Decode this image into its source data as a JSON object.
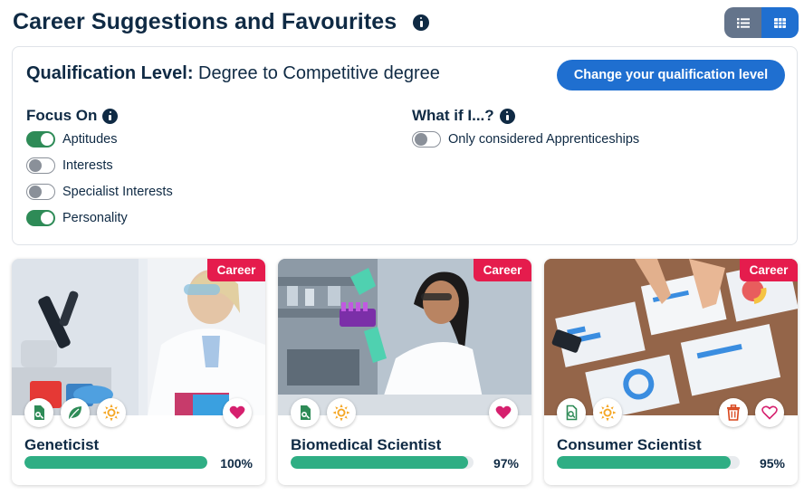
{
  "header": {
    "title": "Career Suggestions and Favourites",
    "info_icon": "info-icon",
    "view_toggle": {
      "list_icon": "list-icon",
      "grid_icon": "grid-icon",
      "active": "grid"
    }
  },
  "qualification": {
    "label": "Qualification Level:",
    "value": "Degree to Competitive degree",
    "change_button": "Change your qualification level"
  },
  "focus_on": {
    "heading": "Focus On",
    "toggles": [
      {
        "label": "Aptitudes",
        "on": true
      },
      {
        "label": "Interests",
        "on": false
      },
      {
        "label": "Specialist Interests",
        "on": false
      },
      {
        "label": "Personality",
        "on": true
      }
    ]
  },
  "what_if": {
    "heading": "What if I...?",
    "toggles": [
      {
        "label": "Only considered Apprenticeships",
        "on": false
      }
    ]
  },
  "colors": {
    "brand_blue": "#1f6fd0",
    "navy": "#0f2a44",
    "toggle_on": "#2e8b57",
    "progress": "#2fae84",
    "badge": "#e51c4d",
    "favourite": "#d6206e"
  },
  "careers": [
    {
      "badge": "Career",
      "name": "Geneticist",
      "match": "100%",
      "match_value": 100,
      "icons": [
        "aptitude-doc-icon",
        "leaf-icon",
        "sun-icon"
      ],
      "action_icons": [
        "heart-filled-icon"
      ]
    },
    {
      "badge": "Career",
      "name": "Biomedical Scientist",
      "match": "97%",
      "match_value": 97,
      "icons": [
        "aptitude-doc-icon",
        "sun-icon"
      ],
      "action_icons": [
        "heart-filled-icon"
      ]
    },
    {
      "badge": "Career",
      "name": "Consumer Scientist",
      "match": "95%",
      "match_value": 95,
      "icons": [
        "aptitude-doc-outline-icon",
        "sun-icon"
      ],
      "action_icons": [
        "trash-icon",
        "heart-outline-icon"
      ]
    }
  ]
}
